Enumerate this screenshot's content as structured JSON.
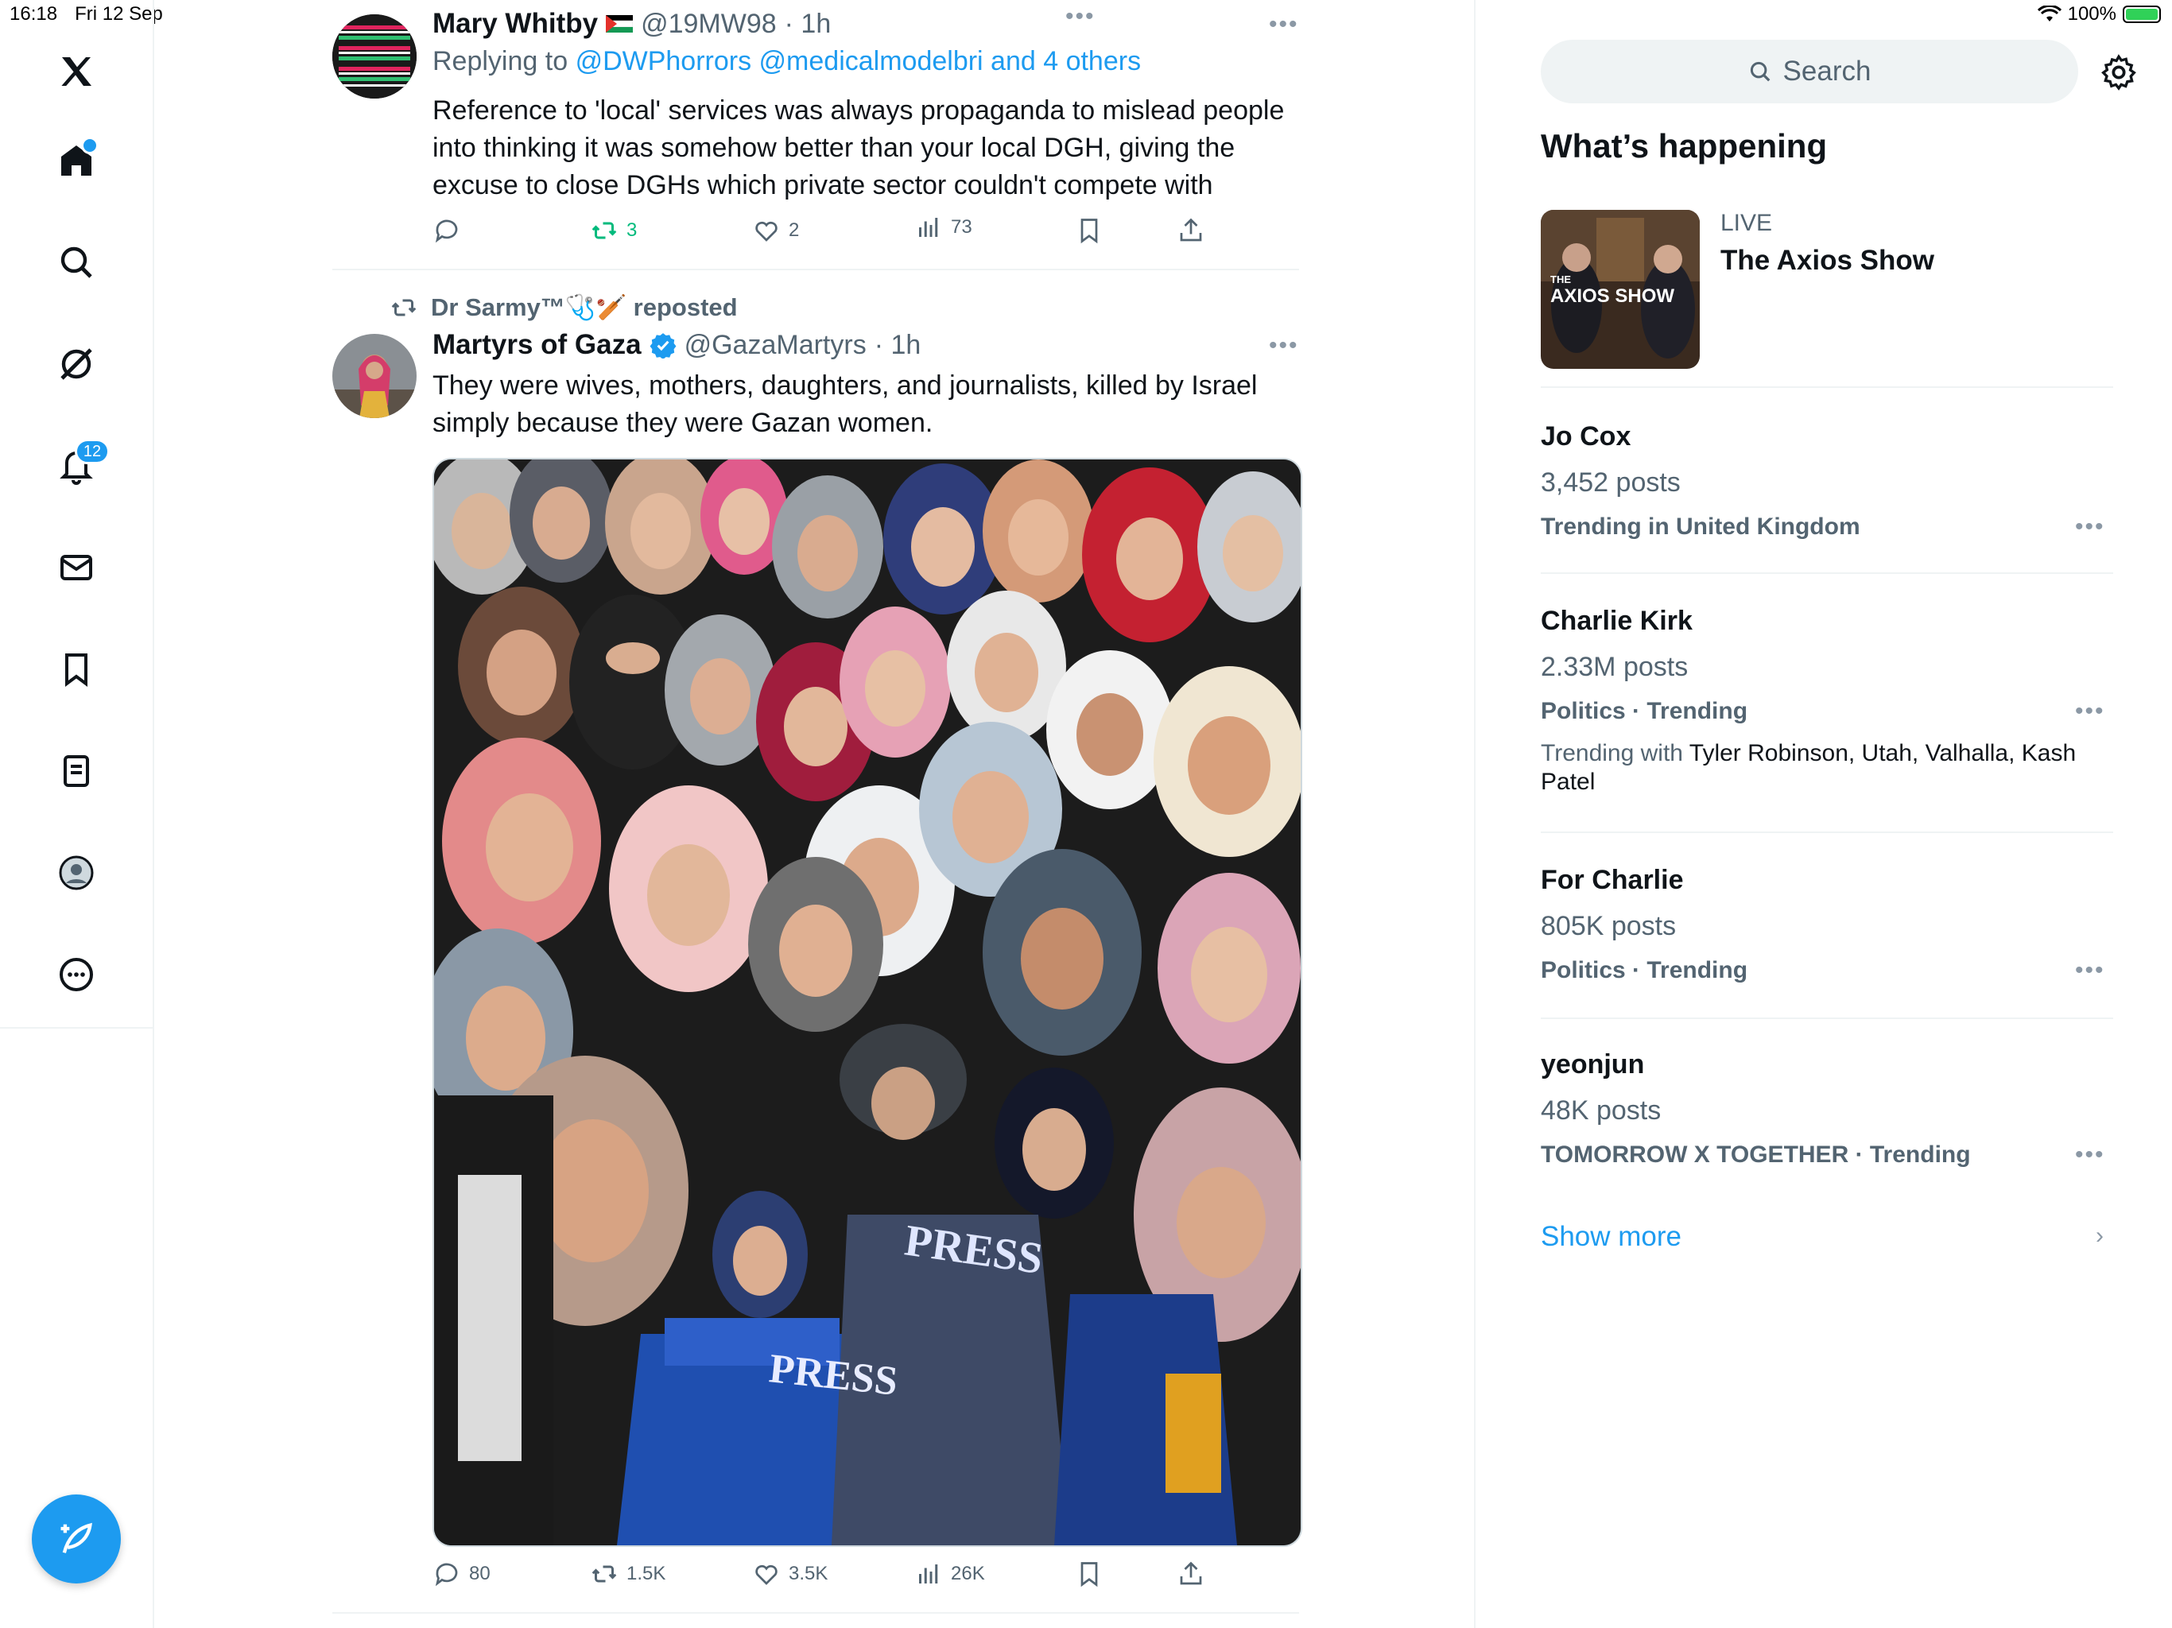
{
  "status_bar": {
    "time": "16:18",
    "date": "Fri 12 Sep",
    "battery": "100%"
  },
  "left_nav": {
    "notifications_count": "12",
    "items": [
      "x-logo",
      "home",
      "explore",
      "grok",
      "notifications",
      "messages",
      "bookmarks",
      "lists",
      "profile",
      "more"
    ]
  },
  "tweets": [
    {
      "author": "Mary Whitby",
      "handle": "@19MW98",
      "time": "· 1h",
      "replying_label": "Replying to",
      "replying_to": "@DWPhorrors @medicalmodelbri and 4 others",
      "text": "Reference to 'local' services was always propaganda to mislead people into thinking it was somehow better than your local DGH, giving the excuse to close DGHs which private sector couldn't compete with",
      "retweets": "3",
      "likes": "2",
      "views": "73"
    },
    {
      "repost_by": "Dr Sarmy™🩺🏏 reposted",
      "author": "Martyrs of Gaza",
      "handle": "@GazaMartyrs",
      "time": "· 1h",
      "text": "They were wives, mothers, daughters, and journalists, killed by Israel simply because they were Gazan women.",
      "image_text_1": "PRESS",
      "image_text_2": "PRESS",
      "replies": "80",
      "retweets": "1.5K",
      "likes": "3.5K",
      "views": "26K"
    }
  ],
  "right_column": {
    "search_placeholder": "Search",
    "section_title": "What’s happening",
    "live": {
      "label": "LIVE",
      "title": "The Axios Show",
      "thumb_text": "AXIOS SHOW",
      "thumb_small": "THE"
    },
    "trends": [
      {
        "name": "Jo Cox",
        "count": "3,452 posts",
        "meta": "Trending in United Kingdom"
      },
      {
        "name": "Charlie Kirk",
        "count": "2.33M posts",
        "meta": "Politics · Trending",
        "with_label": "Trending with",
        "with": "Tyler Robinson, Utah, Valhalla, Kash Patel"
      },
      {
        "name": "For Charlie",
        "count": "805K posts",
        "meta": "Politics · Trending"
      },
      {
        "name": "yeonjun",
        "count": "48K posts",
        "meta": "TOMORROW X TOGETHER · Trending"
      }
    ],
    "show_more": "Show more"
  },
  "colors": {
    "accent": "#1d9bf0",
    "retweet": "#00ba7c",
    "text": "#0f1419",
    "muted": "#536471"
  }
}
